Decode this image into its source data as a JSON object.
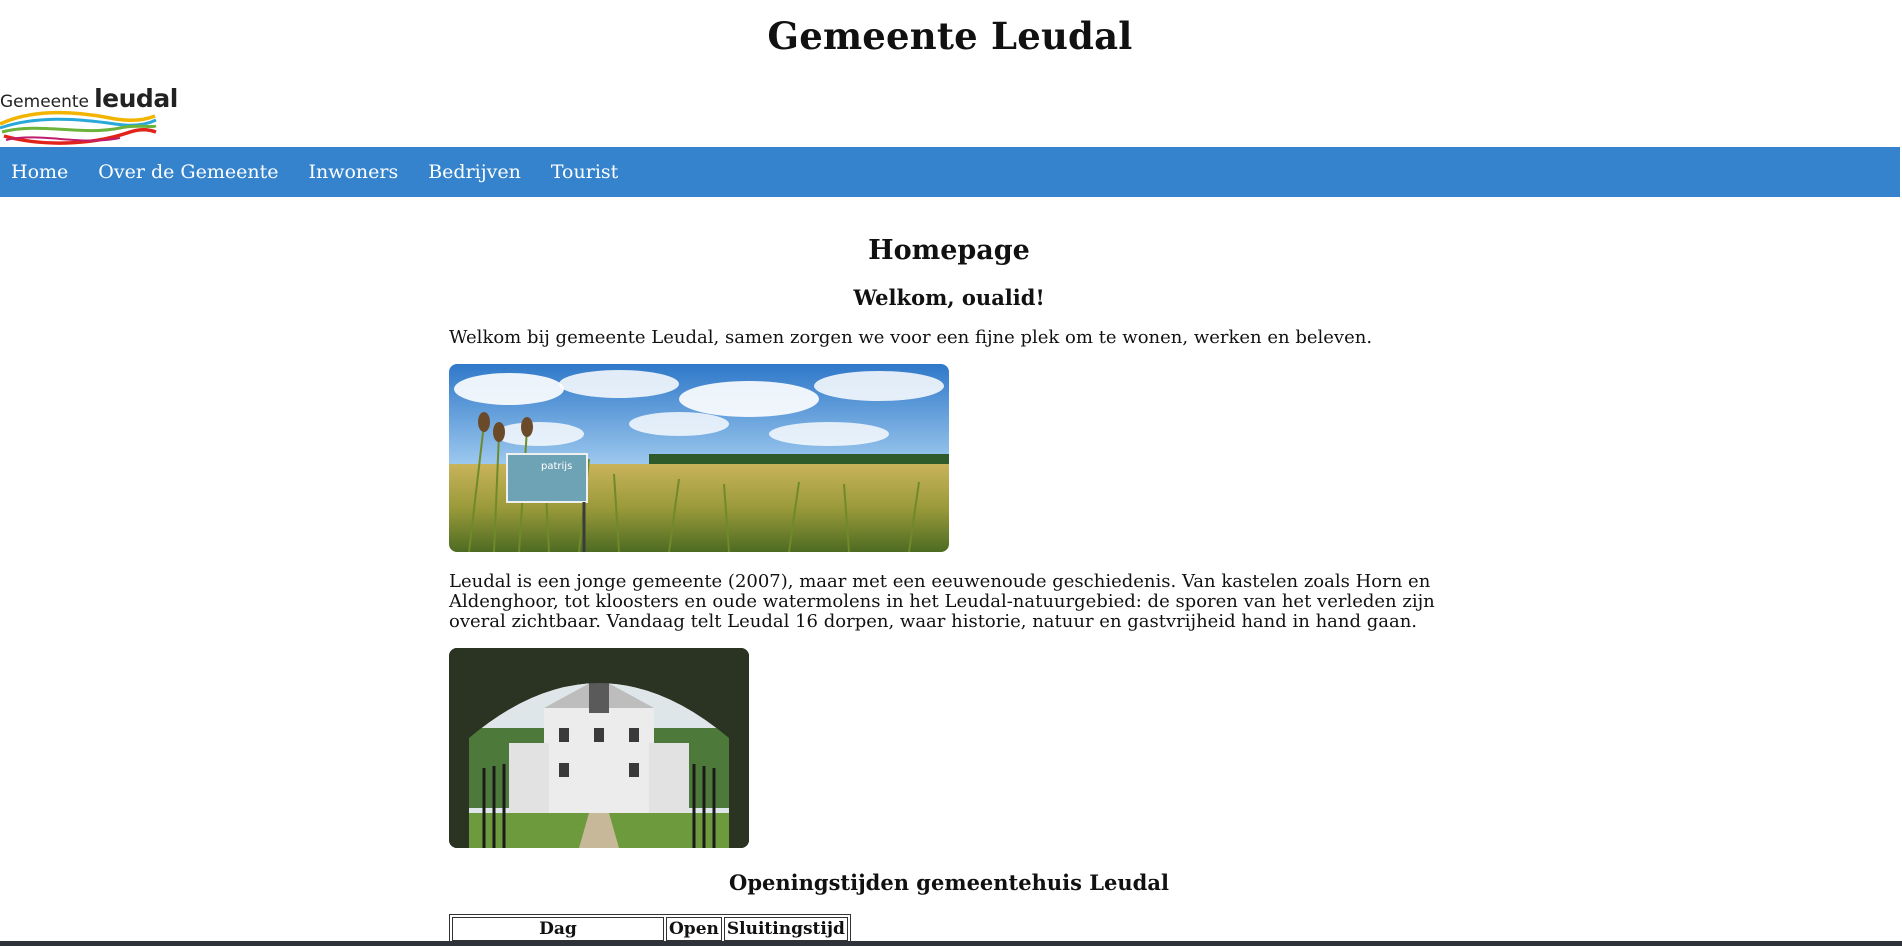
{
  "site": {
    "title": "Gemeente Leudal",
    "logo_text_small": "Gemeente",
    "logo_text_big": "leudal"
  },
  "nav": {
    "items": [
      {
        "label": "Home"
      },
      {
        "label": "Over de Gemeente"
      },
      {
        "label": "Inwoners"
      },
      {
        "label": "Bedrijven"
      },
      {
        "label": "Tourist"
      }
    ],
    "background": "#3483cc"
  },
  "main": {
    "heading": "Homepage",
    "welcome": "Welkom, oualid!",
    "intro": "Welkom bij gemeente Leudal, samen zorgen we voor een fijne plek om te wonen, werken en beleven.",
    "history": "Leudal is een jonge gemeente (2007), maar met een eeuwenoude geschiedenis. Van kastelen zoals Horn en Aldenghoor, tot kloosters en oude watermolens in het Leudal-natuurgebied: de sporen van het verleden zijn overal zichtbaar. Vandaag telt Leudal 16 dorpen, waar historie, natuur en gastvrijheid hand in hand gaan.",
    "field_sign_text": "patrijs",
    "hours_heading": "Openingstijden gemeentehuis Leudal",
    "hours_table": {
      "headers": [
        "Dag",
        "Open",
        "Sluitingstijd"
      ]
    }
  }
}
